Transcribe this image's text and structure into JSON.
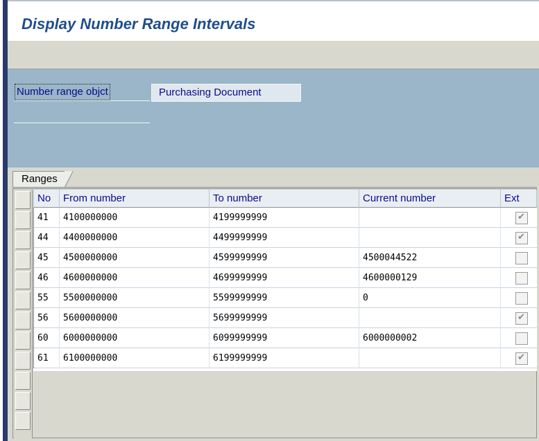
{
  "window": {
    "title": "Display Number Range Intervals"
  },
  "header": {
    "field_label": "Number range objct",
    "field_value": "Purchasing Document"
  },
  "ranges": {
    "tab_label": "Ranges",
    "columns": [
      "No",
      "From number",
      "To number",
      "Current number",
      "Ext"
    ],
    "rows": [
      {
        "no": "41",
        "from": "4100000000",
        "to": "4199999999",
        "current": "",
        "ext": true
      },
      {
        "no": "44",
        "from": "4400000000",
        "to": "4499999999",
        "current": "",
        "ext": true
      },
      {
        "no": "45",
        "from": "4500000000",
        "to": "4599999999",
        "current": "4500044522",
        "ext": false
      },
      {
        "no": "46",
        "from": "4600000000",
        "to": "4699999999",
        "current": "4600000129",
        "ext": false
      },
      {
        "no": "55",
        "from": "5500000000",
        "to": "5599999999",
        "current": "0",
        "ext": false
      },
      {
        "no": "56",
        "from": "5600000000",
        "to": "5699999999",
        "current": "",
        "ext": true
      },
      {
        "no": "60",
        "from": "6000000000",
        "to": "6099999999",
        "current": "6000000002",
        "ext": false
      },
      {
        "no": "61",
        "from": "6100000000",
        "to": "6199999999",
        "current": "",
        "ext": true
      }
    ]
  },
  "colors": {
    "title": "#1f4e8c",
    "header_bg": "#9ab6c8",
    "toolbar_bg": "#d9d8cf",
    "label_text": "#0a0a8a"
  },
  "icons": {
    "ext_checked": "check-icon"
  }
}
